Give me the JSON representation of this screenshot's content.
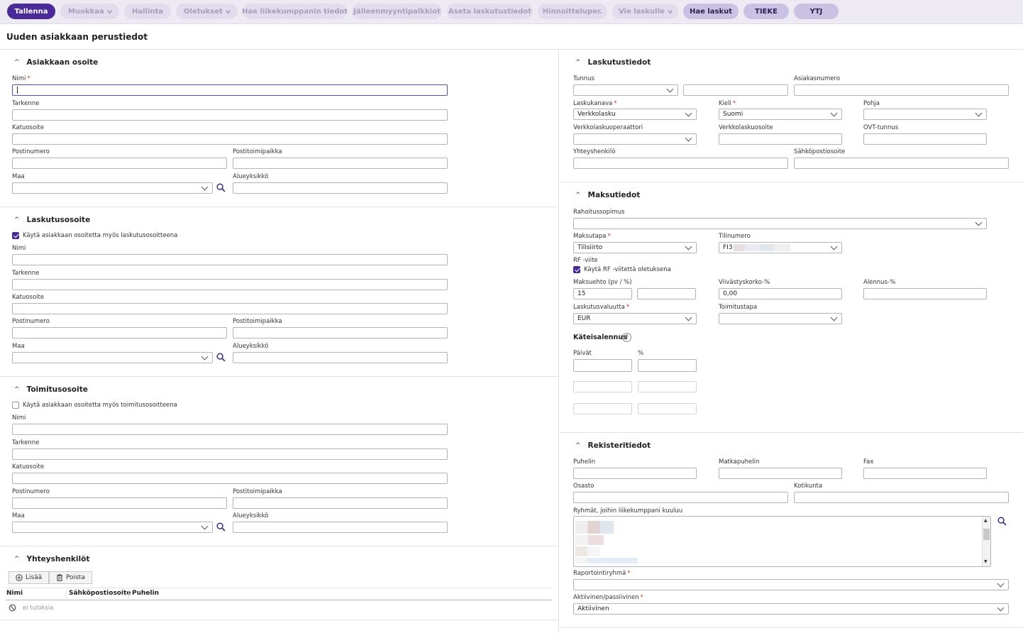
{
  "toolbar": {
    "save": "Tallenna",
    "edit": "Muokkaa",
    "manage": "Hallinta",
    "defaults": "Oletukset",
    "fetch_partner": "Hae liikekumppanin tiedot",
    "resellers": "Jälleenmyyntipalkkiot",
    "set_billing": "Aseta laskutustiedot",
    "pricing": "Hinnoitteluper.",
    "export_invoices": "Vie laskulle",
    "fetch_invoices": "Hae laskut",
    "tieke": "TIEKE",
    "ytj": "YTJ"
  },
  "page_title": "Uuden asiakkaan perustiedot",
  "left": {
    "customer_address": {
      "title": "Asiakkaan osoite",
      "name": "Nimi",
      "extra": "Tarkenne",
      "street": "Katuosoite",
      "postcode": "Postinumero",
      "city": "Postitoimipaikka",
      "country": "Maa",
      "region": "Alueyksikkö"
    },
    "billing_address": {
      "title": "Laskutusosoite",
      "use_customer": "Käytä asiakkaan osoitetta myös laskutusosoitteena",
      "name": "Nimi",
      "extra": "Tarkenne",
      "street": "Katuosoite",
      "postcode": "Postinumero",
      "city": "Postitoimipaikka",
      "country": "Maa",
      "region": "Alueyksikkö"
    },
    "delivery_address": {
      "title": "Toimitusosoite",
      "use_customer": "Käytä asiakkaan osoitetta myös toimitusosoitteena",
      "name": "Nimi",
      "extra": "Tarkenne",
      "street": "Katuosoite",
      "postcode": "Postinumero",
      "city": "Postitoimipaikka",
      "country": "Maa",
      "region": "Alueyksikkö"
    },
    "contacts": {
      "title": "Yhteyshenkilöt",
      "add": "Lisää",
      "remove": "Poista",
      "col_name": "Nimi",
      "col_email": "Sähköpostiosoite",
      "col_phone": "Puhelin",
      "empty": "ei tuloksia"
    }
  },
  "right": {
    "billing": {
      "title": "Laskutustiedot",
      "id": "Tunnus",
      "customer_number": "Asiakasnumero",
      "channel": "Laskukanava",
      "channel_value": "Verkkolasku",
      "language": "Kieli",
      "language_value": "Suomi",
      "template": "Pohja",
      "operator": "Verkkolaskuoperaattori",
      "einvoice_address": "Verkkolaskuosoite",
      "ovt": "OVT-tunnus",
      "contact": "Yhteyshenkilö",
      "email": "Sähköpostiosoite"
    },
    "payment": {
      "title": "Maksutiedot",
      "financing": "Rahoitussopimus",
      "method": "Maksutapa",
      "method_value": "Tilisiirto",
      "account": "Tilinumero",
      "account_value": "FI3",
      "rf": "RF -viite",
      "rf_default": "Käytä RF -viitettä oletuksena",
      "terms": "Maksuehto (pv / %)",
      "terms_value": "15",
      "penalty": "Viivästyskorko-%",
      "penalty_value": "0,00",
      "discount": "Alennus-%",
      "currency": "Laskutusvaluutta",
      "currency_value": "EUR",
      "delivery": "Toimitustapa",
      "cash_discount": "Käteisalennus",
      "days": "Päivät",
      "percent": "%"
    },
    "registry": {
      "title": "Rekisteritiedot",
      "phone": "Puhelin",
      "mobile": "Matkapuhelin",
      "fax": "Fax",
      "department": "Osasto",
      "municipality": "Kotikunta",
      "groups": "Ryhmät, joihin liikekumppani kuuluu",
      "reporting_group": "Raportointiryhmä",
      "active": "Aktiivinen/passiivinen",
      "active_value": "Aktiivinen"
    }
  },
  "colors": {
    "primary": "#4a2a98",
    "toolbar_bg": "#eeeaf4"
  }
}
